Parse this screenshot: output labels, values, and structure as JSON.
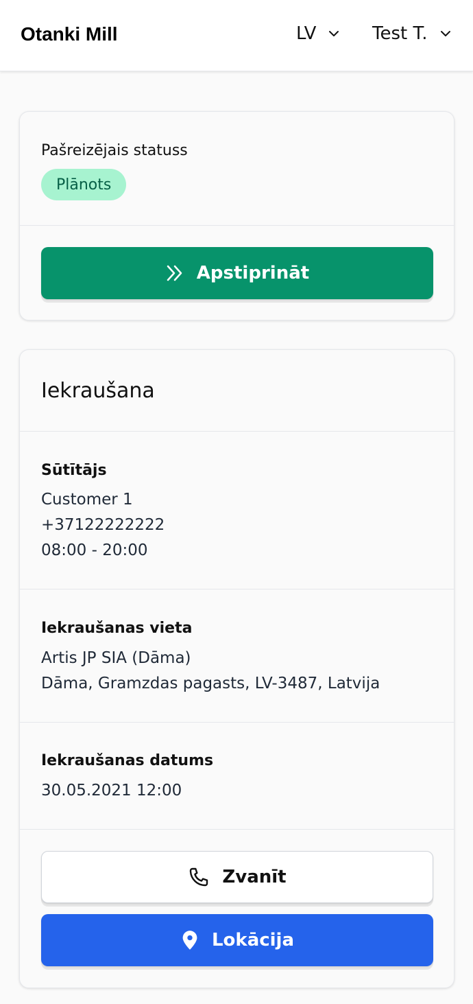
{
  "header": {
    "brand": "Otanki Mill",
    "language": "LV",
    "user": "Test T."
  },
  "status_card": {
    "label": "Pašreizējais statuss",
    "badge": "Plānots",
    "confirm_button": "Apstiprināt",
    "confirm_icon": "chevron-double-right-icon"
  },
  "loading_card": {
    "title": "Iekraušana",
    "sender": {
      "label": "Sūtītājs",
      "name": "Customer 1",
      "phone": "+37122222222",
      "hours": "08:00 - 20:00"
    },
    "location": {
      "label": "Iekraušanas vieta",
      "name": "Artis JP SIA (Dāma)",
      "address": "Dāma, Gramzdas pagasts, LV-3487, Latvija"
    },
    "date": {
      "label": "Iekraušanas datums",
      "value": "30.05.2021 12:00"
    },
    "call_button": "Zvanīt",
    "location_button": "Lokācija"
  },
  "colors": {
    "confirm": "#07936b",
    "badge_bg": "#a7f3d0",
    "badge_text": "#065f46",
    "location_button": "#2563eb"
  }
}
